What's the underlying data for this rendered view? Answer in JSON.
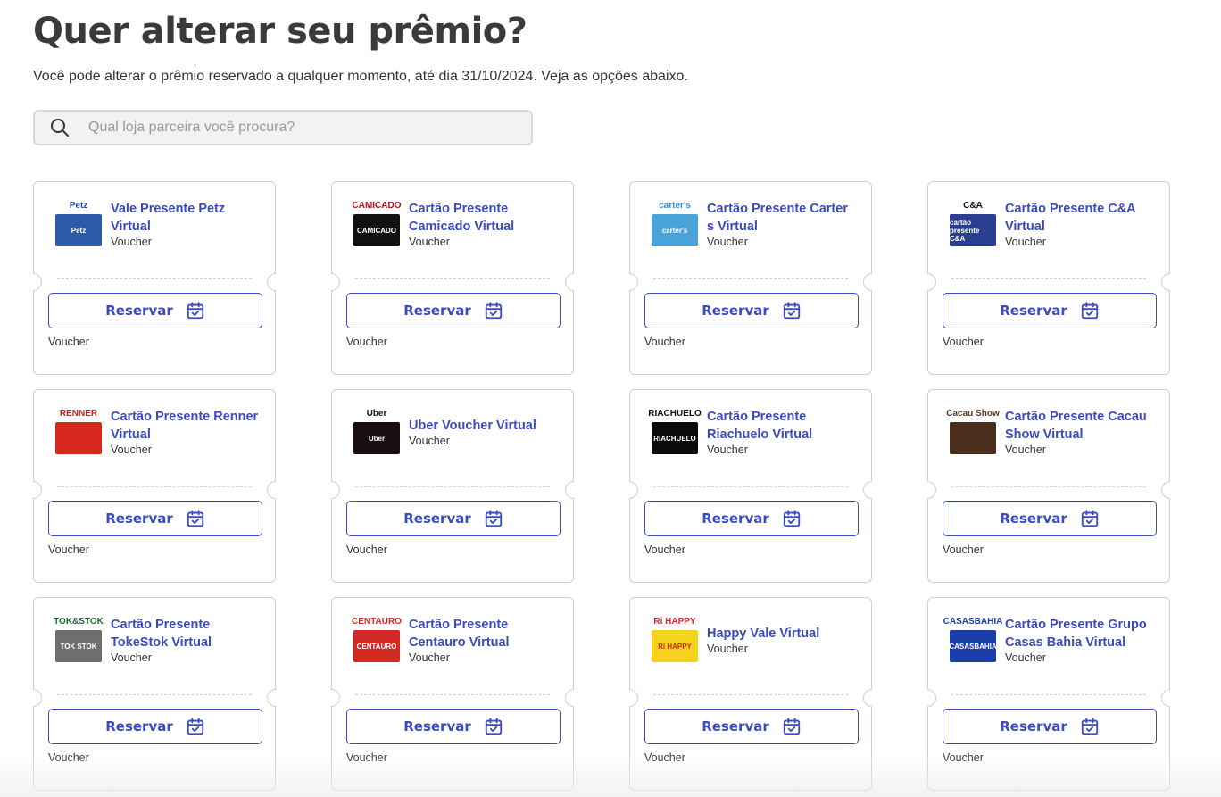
{
  "header": {
    "title": "Quer alterar seu prêmio?",
    "subtitle": "Você pode alterar o prêmio reservado a qualquer momento, até dia 31/10/2024. Veja as opções abaixo."
  },
  "search": {
    "placeholder": "Qual loja parceira você procura?",
    "value": ""
  },
  "colors": {
    "accent": "#3b4bbf",
    "border": "#d0d0d0"
  },
  "cards": [
    {
      "title": "Vale Presente Petz Virtual",
      "type": "Voucher",
      "button": "Reservar",
      "footer": "Voucher",
      "logo_text": "Petz",
      "logo_card_text": "Petz",
      "logo_color": "#2a5aa8",
      "logo_text_color": "#1f4e9c"
    },
    {
      "title": "Cartão Presente Camicado Virtual",
      "type": "Voucher",
      "button": "Reservar",
      "footer": "Voucher",
      "logo_text": "CAMICADO",
      "logo_card_text": "CAMICADO",
      "logo_color": "#111111",
      "logo_text_color": "#b01020"
    },
    {
      "title": "Cartão Presente Carter s Virtual",
      "type": "Voucher",
      "button": "Reservar",
      "footer": "Voucher",
      "logo_text": "carter's",
      "logo_card_text": "carter's",
      "logo_color": "#4aa3d8",
      "logo_text_color": "#2f8fcc"
    },
    {
      "title": "Cartão Presente C&A Virtual",
      "type": "Voucher",
      "button": "Reservar",
      "footer": "Voucher",
      "logo_text": "C&A",
      "logo_card_text": "cartão presente C&A",
      "logo_color": "#2a3f8f",
      "logo_text_color": "#111111"
    },
    {
      "title": "Cartão Presente Renner Virtual",
      "type": "Voucher",
      "button": "Reservar",
      "footer": "Voucher",
      "logo_text": "RENNER",
      "logo_card_text": "",
      "logo_color": "#d6281c",
      "logo_text_color": "#c8202a"
    },
    {
      "title": "Uber Voucher Virtual",
      "type": "Voucher",
      "button": "Reservar",
      "footer": "Voucher",
      "logo_text": "Uber",
      "logo_card_text": "Uber",
      "logo_color": "#1a0d10",
      "logo_text_color": "#111111"
    },
    {
      "title": "Cartão Presente Riachuelo Virtual",
      "type": "Voucher",
      "button": "Reservar",
      "footer": "Voucher",
      "logo_text": "RIACHUELO",
      "logo_card_text": "RIACHUELO",
      "logo_color": "#0a0a0a",
      "logo_text_color": "#111111"
    },
    {
      "title": "Cartão Presente Cacau Show Virtual",
      "type": "Voucher",
      "button": "Reservar",
      "footer": "Voucher",
      "logo_text": "Cacau Show",
      "logo_card_text": "",
      "logo_color": "#4a2e1c",
      "logo_text_color": "#5a3a26"
    },
    {
      "title": "Cartão Presente TokeStok Virtual",
      "type": "Voucher",
      "button": "Reservar",
      "footer": "Voucher",
      "logo_text": "TOK&STOK",
      "logo_card_text": "TOK STOK",
      "logo_color": "#6e6e6e",
      "logo_text_color": "#1f6b3a"
    },
    {
      "title": "Cartão Presente Centauro Virtual",
      "type": "Voucher",
      "button": "Reservar",
      "footer": "Voucher",
      "logo_text": "CENTAURO",
      "logo_card_text": "CENTAURO",
      "logo_color": "#d22a22",
      "logo_text_color": "#d22a22"
    },
    {
      "title": "Happy Vale Virtual",
      "type": "Voucher",
      "button": "Reservar",
      "footer": "Voucher",
      "logo_text": "Ri HAPPY",
      "logo_card_text": "Ri HAPPY",
      "logo_color": "#f6d31c",
      "logo_text_color": "#d8262a"
    },
    {
      "title": "Cartão Presente Grupo Casas Bahia Virtual",
      "type": "Voucher",
      "button": "Reservar",
      "footer": "Voucher",
      "logo_text": "CASASBAHIA",
      "logo_card_text": "CASASBAHIA",
      "logo_color": "#1b3fa8",
      "logo_text_color": "#1b3fa8"
    }
  ]
}
